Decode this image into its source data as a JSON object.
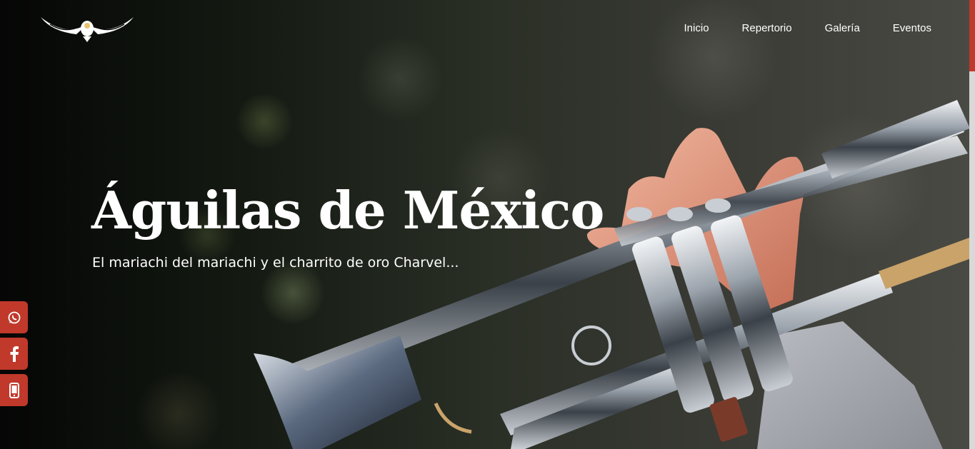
{
  "logo": {
    "icon": "eagle-wings-logo"
  },
  "nav": {
    "items": [
      "Inicio",
      "Repertorio",
      "Galería",
      "Eventos"
    ]
  },
  "hero": {
    "title": "Águilas de México",
    "subtitle": "El mariachi del mariachi y el charrito de oro Charvel..."
  },
  "social": {
    "buttons": [
      {
        "icon": "whatsapp-icon"
      },
      {
        "icon": "facebook-icon"
      },
      {
        "icon": "phone-icon"
      }
    ]
  },
  "colors": {
    "accent": "#c0392b",
    "text": "#ffffff"
  }
}
